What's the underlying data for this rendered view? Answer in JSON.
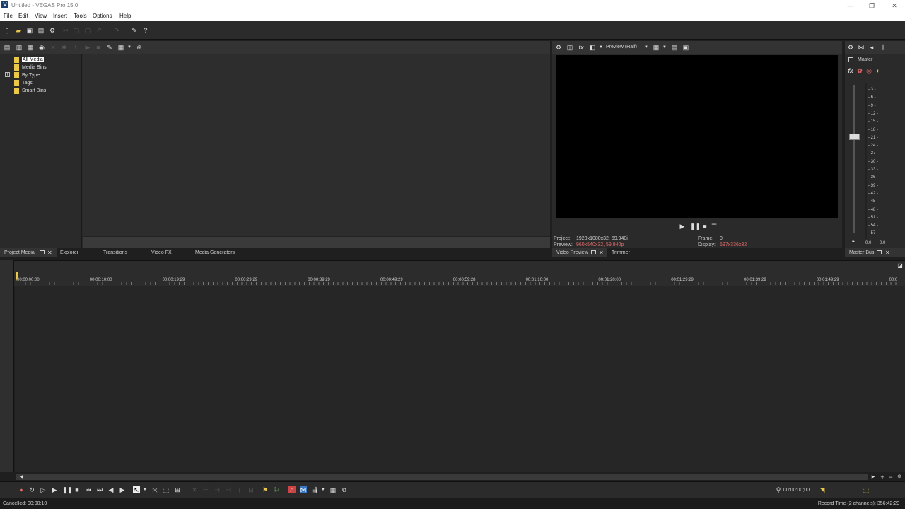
{
  "app": {
    "window_title": "Untitled - VEGAS Pro 15.0",
    "logo_letter": "V"
  },
  "menu": [
    "File",
    "Edit",
    "View",
    "Insert",
    "Tools",
    "Options",
    "Help"
  ],
  "project_media": {
    "tree": [
      {
        "label": "All Media",
        "selected": true
      },
      {
        "label": "Media Bins",
        "selected": false
      },
      {
        "label": "By Type",
        "selected": false
      },
      {
        "label": "Tags",
        "selected": false
      },
      {
        "label": "Smart Bins",
        "selected": false
      }
    ],
    "expander": "+"
  },
  "left_tabs": [
    "Project Media",
    "Explorer",
    "Transitions",
    "Video FX",
    "Media Generators"
  ],
  "preview": {
    "quality": "Preview (Half)",
    "project_label": "Project:",
    "project_value": "1920x1080x32, 59.940i",
    "preview_label": "Preview:",
    "preview_value": "960x540x32, 59.940p",
    "frame_label": "Frame:",
    "frame_value": "0",
    "display_label": "Display:",
    "display_value": "597x336x32",
    "tabs": [
      "Video Preview",
      "Trimmer"
    ]
  },
  "master": {
    "label": "Master",
    "scale": [
      "3",
      "6",
      "9",
      "12",
      "15",
      "18",
      "21",
      "24",
      "27",
      "30",
      "33",
      "36",
      "39",
      "42",
      "45",
      "48",
      "51",
      "54",
      "57"
    ],
    "value_left": "0.0",
    "value_right": "0.0",
    "tab": "Master Bus"
  },
  "timeline": {
    "ruler": [
      "00:00:00;00",
      "00:00:10;00",
      "00:00:19;29",
      "00:00:29;29",
      "00:00:39;29",
      "00:00:49;29",
      "00:00:59;28",
      "00:01:10;00",
      "00:01:20;00",
      "00:01:29;29",
      "00:01:39;29",
      "00:01:49;29",
      "00:0"
    ]
  },
  "transport": {
    "time": "00:00:00;00"
  },
  "status": {
    "left": "Cancelled: 00:00:10",
    "right": "Record Time (2 channels): 356:42:20"
  }
}
